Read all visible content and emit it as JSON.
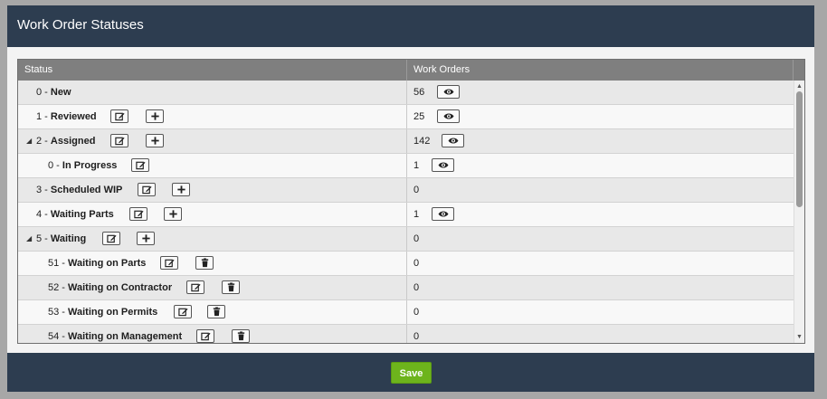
{
  "header": {
    "title": "Work Order Statuses"
  },
  "grid": {
    "columns": {
      "status": "Status",
      "work_orders": "Work Orders"
    },
    "rows": [
      {
        "code": "0 - ",
        "name": "New",
        "expander": "",
        "actions": [],
        "count": "56",
        "has_view": true
      },
      {
        "code": "1 - ",
        "name": "Reviewed",
        "expander": "",
        "actions": [
          "edit",
          "add"
        ],
        "count": "25",
        "has_view": true
      },
      {
        "code": "2 - ",
        "name": "Assigned",
        "expander": "◢",
        "actions": [
          "edit",
          "add"
        ],
        "count": "142",
        "has_view": true
      },
      {
        "code": "0 - ",
        "name": "In Progress",
        "expander": "",
        "actions": [
          "edit"
        ],
        "count": "1",
        "has_view": true
      },
      {
        "code": "3 - ",
        "name": "Scheduled WIP",
        "expander": "",
        "actions": [
          "edit",
          "add"
        ],
        "count": "0",
        "has_view": false
      },
      {
        "code": "4 - ",
        "name": "Waiting Parts",
        "expander": "",
        "actions": [
          "edit",
          "add"
        ],
        "count": "1",
        "has_view": true
      },
      {
        "code": "5 - ",
        "name": "Waiting",
        "expander": "◢",
        "actions": [
          "edit",
          "add"
        ],
        "count": "0",
        "has_view": false
      },
      {
        "code": "51 - ",
        "name": "Waiting on Parts",
        "expander": "",
        "actions": [
          "edit",
          "delete"
        ],
        "count": "0",
        "has_view": false
      },
      {
        "code": "52 - ",
        "name": "Waiting on Contractor",
        "expander": "",
        "actions": [
          "edit",
          "delete"
        ],
        "count": "0",
        "has_view": false
      },
      {
        "code": "53 - ",
        "name": "Waiting on Permits",
        "expander": "",
        "actions": [
          "edit",
          "delete"
        ],
        "count": "0",
        "has_view": false
      },
      {
        "code": "54 - ",
        "name": "Waiting on Management",
        "expander": "",
        "actions": [
          "edit",
          "delete"
        ],
        "count": "0",
        "has_view": false
      }
    ],
    "scroll": {
      "up_icon": "▲",
      "down_icon": "▼"
    }
  },
  "footer": {
    "save_label": "Save"
  },
  "colors": {
    "header_bg": "#2d3d50",
    "save_bg": "#6db41c"
  }
}
